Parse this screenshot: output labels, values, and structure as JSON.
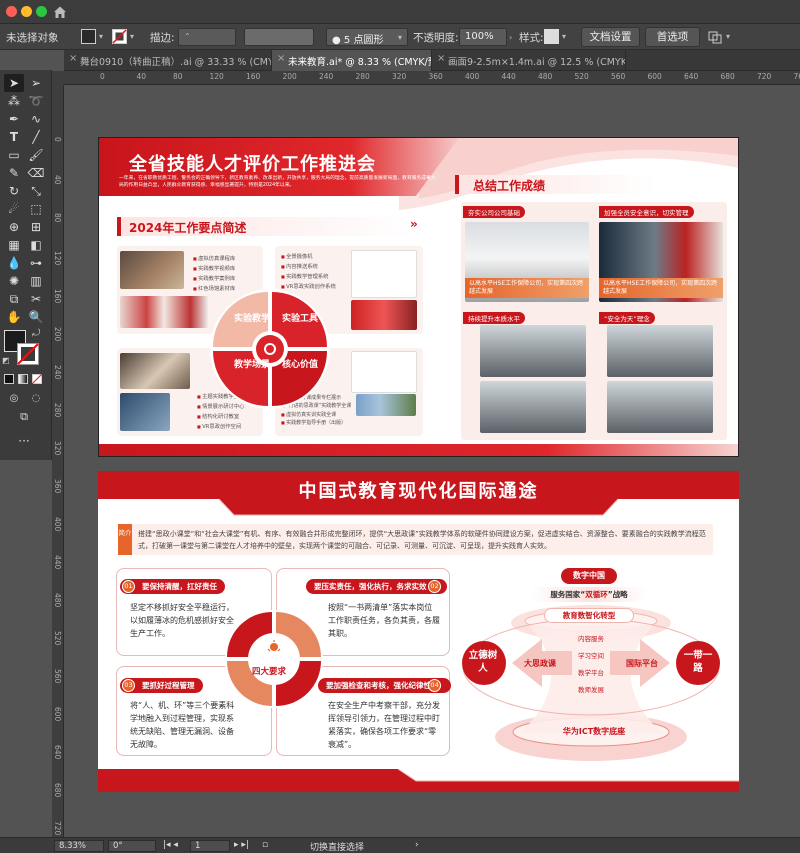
{
  "window": {
    "traffic_lights": [
      "#ff5f57",
      "#febc2e",
      "#28c840"
    ]
  },
  "control_bar": {
    "selection_status": "未选择对象",
    "stroke_label": "描边:",
    "brush_label": "5 点圆形",
    "opacity_label": "不透明度:",
    "opacity_value": "100%",
    "style_label": "样式:",
    "doc_setup_button": "文档设置",
    "preferences_button": "首选项"
  },
  "tabs": [
    {
      "label": "舞台0910（转曲正稿）.ai @ 33.33 % (CMYK/预览)",
      "active": false
    },
    {
      "label": "未来教育.ai* @ 8.33 % (CMYK/预览)",
      "active": true
    },
    {
      "label": "画面9-2.5m×1.4m.ai @ 12.5 % (CMYK/预览)",
      "active": false
    }
  ],
  "ruler": {
    "top_numbers": [
      "0",
      "40",
      "80",
      "120",
      "160",
      "200",
      "240",
      "280",
      "320",
      "360",
      "400",
      "440",
      "480",
      "520",
      "560",
      "600",
      "640",
      "680",
      "720",
      "760"
    ],
    "left_numbers": [
      "0",
      "40",
      "80",
      "120",
      "160",
      "200",
      "240",
      "280",
      "320",
      "360",
      "400",
      "440",
      "480",
      "520",
      "560",
      "600",
      "640",
      "680",
      "720"
    ]
  },
  "artboard1": {
    "title": "全省技能人才评价工作推进会",
    "subtitle": "一年来，在省职教优质工程、警务会的正确领导下，新区教育素养、改革出新，开放共享，服务大局的理念，提前高质量发展新局面，教育服务成果大局的作用日益凸显，人民群众教育获得感、幸福感显著提升，特别是2024年以来。",
    "section_left": "2024年工作要点简述",
    "section_right": "总结工作成绩",
    "chevrons": "»",
    "list_tl": [
      "虚拟仿真课程库",
      "实践教学视频库",
      "实践教学案例库",
      "红色场馆素材库"
    ],
    "list_tr": [
      "全景摄像机",
      "内容推送系统",
      "实践教学管理系统",
      "VR思政实践创作系统"
    ],
    "list_bl": [
      "主题实践教学空间",
      "情景展示研讨中心",
      "结构化研讨教室",
      "VR思政创作空间"
    ],
    "list_br": [
      "人民公开课成果专栏展示",
      "“行进的思政课”实践教学全课",
      "虚拟仿真实训实践全课",
      "实践教学指导手册（出版）"
    ],
    "quadrants": [
      "实验教学",
      "实验工具",
      "教学场景",
      "核心价值"
    ],
    "tags": [
      "夯实公司公司基础",
      "加强全员安全意识，切实管理",
      "持续提升本质水平",
      "“安全为天”理念"
    ],
    "photo_captions": [
      "以高水平HSE工作保障公司，实现第四次跨越式发展",
      "以高水平HSE工作保障公司，实现第四次跨越式发展"
    ]
  },
  "artboard2": {
    "title": "中国式教育现代化国际通途",
    "intro_tag": "简介",
    "intro_text": "搭建“思政小课堂”和“社会大课堂”有机、有序、有效融合并形成完整闭环，提供“大思政课”实践教学体系的软硬件协同建设方案，促进虚实结合、资源整合、要素融合的实践教学流程范式，打破第一课堂与第二课堂在人才培养中的壁垒，实现两个课堂的可融合、可记录、可测量、可沉淀、可呈现，提升实践育人实效。",
    "cards": [
      {
        "num": "01",
        "title": "要保持清醒，扛好责任",
        "body": "坚定不移抓好安全平稳运行，以如履薄冰的危机感抓好安全生产工作。"
      },
      {
        "num": "02",
        "title": "要压实责任，强化执行，务求实效",
        "body": "按照“一书两清单”落实本岗位工作职责任务，各负其责，各履其职。"
      },
      {
        "num": "03",
        "title": "要抓好过程管理",
        "body": "将“人、机、环”等三个要素科学地融入到过程管理，实现系统无缺陷、管理无漏洞、设备无故障。"
      },
      {
        "num": "04",
        "title": "要加强检查和考核，强化纪律性",
        "body": "在安全生产中考察干部，充分发挥领导引领力，在管理过程中盯紧落实，确保各项工作要求“零衰减”。"
      }
    ],
    "center_label": "四大要求",
    "right": {
      "top_node": "数字中国",
      "serve_pre": "服务国家“",
      "serve_em": "双循环",
      "serve_post": "”战略",
      "transform": "教育数智化转型",
      "left_node": "立德树人",
      "right_node": "一带一路",
      "left_arrow": "大思政课",
      "right_arrow": "国际平台",
      "items": [
        "内容服务",
        "学习空间",
        "教学平台",
        "教师发展"
      ],
      "base": "华为ICT数字底座"
    }
  },
  "status_bar": {
    "zoom": "8.33%",
    "rotation": "0°",
    "artboard_index": "1",
    "tool_hint": "切换直接选择"
  },
  "colors": {
    "accent_red": "#c8161d",
    "accent_orange": "#e5652b",
    "ui_dark": "#3b3b3b",
    "canvas": "#535353"
  }
}
